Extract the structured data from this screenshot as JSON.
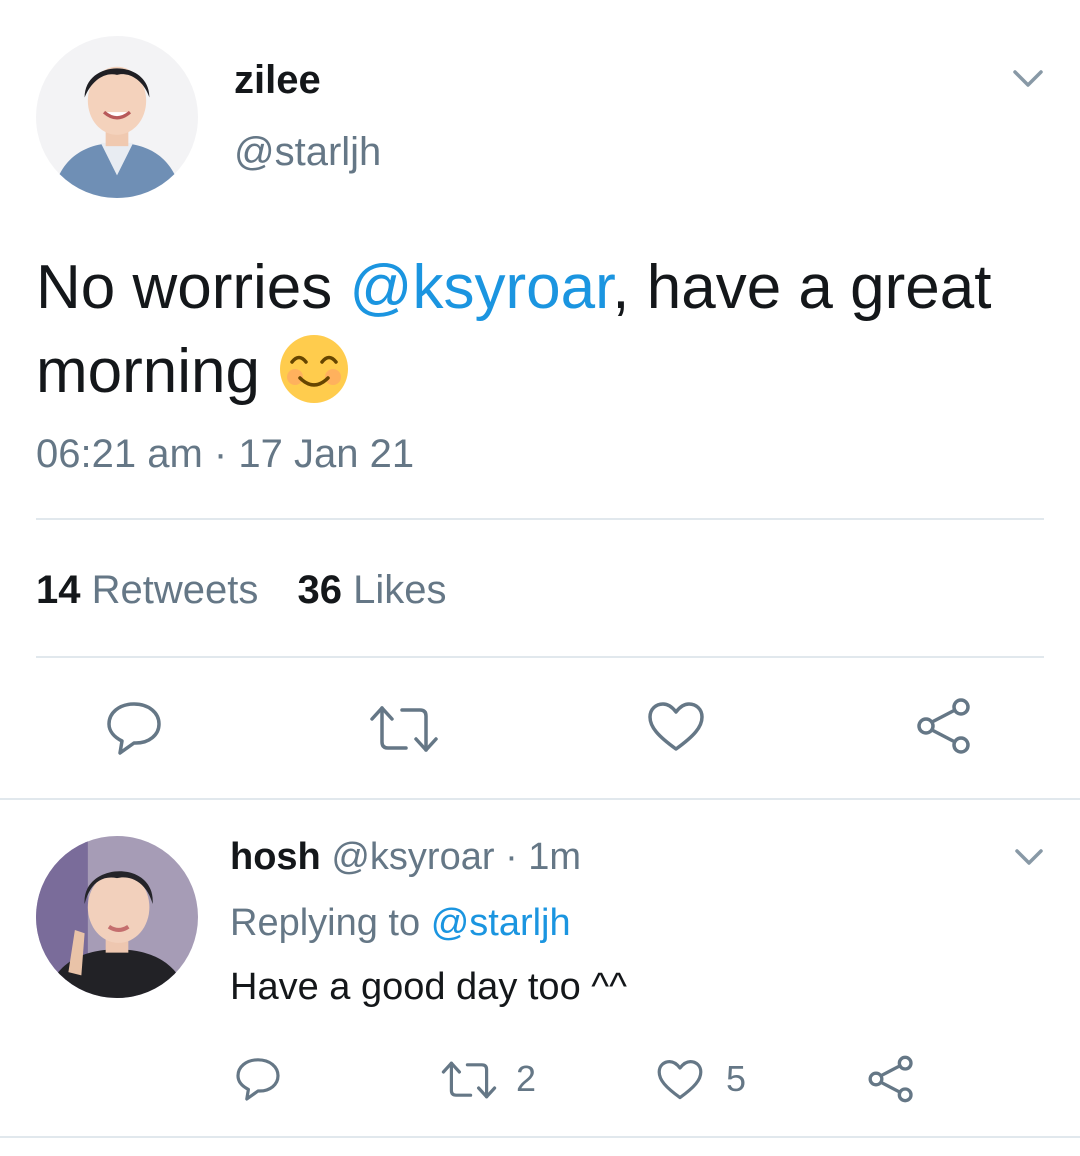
{
  "tweet": {
    "display_name": "zilee",
    "handle": "@starljh",
    "text_before": "No worries ",
    "mention": "@ksyroar",
    "text_after": ", have a great morning ",
    "emoji": "☺️",
    "time": "06:21 am",
    "date_sep": "·",
    "date": "17 Jan 21",
    "retweets_count": "14",
    "retweets_label": "Retweets",
    "likes_count": "36",
    "likes_label": "Likes"
  },
  "reply": {
    "display_name": "hosh",
    "handle": "@ksyroar",
    "dot": "·",
    "age": "1m",
    "replying_label": "Replying to",
    "replying_handle": "@starljh",
    "text": "Have a good day too ^^",
    "retweet_count": "2",
    "like_count": "5"
  },
  "icons": {
    "menu": "chevron-down-icon",
    "reply": "reply-icon",
    "retweet": "retweet-icon",
    "like": "heart-icon",
    "share": "share-icon"
  },
  "colors": {
    "link": "#1b95e0",
    "muted": "#657786",
    "divider": "#e1e8ed",
    "text": "#14171a"
  }
}
